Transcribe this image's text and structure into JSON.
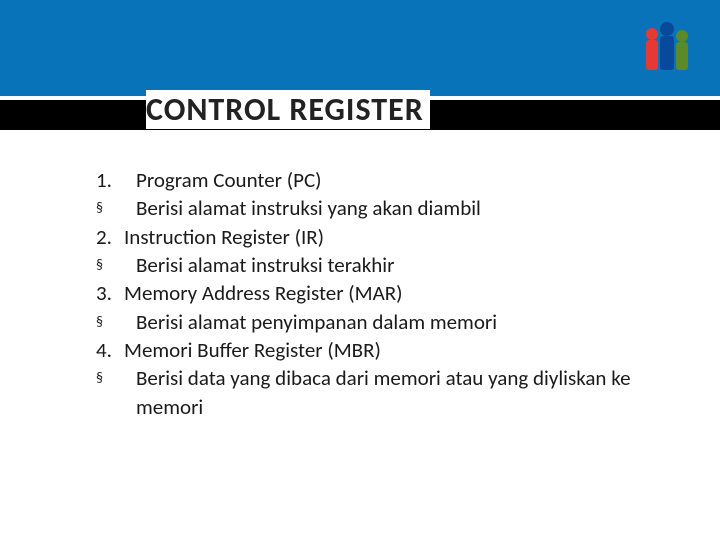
{
  "title": "CONTROL REGISTER",
  "items": [
    {
      "marker": "1.",
      "text": "Program Counter (PC)"
    },
    {
      "marker": "§",
      "text": "Berisi alamat instruksi yang akan diambil"
    },
    {
      "marker": "2.",
      "text": "Instruction Register (IR)"
    },
    {
      "marker": "§",
      "text": "Berisi alamat instruksi terakhir"
    },
    {
      "marker": "3.",
      "text": "Memory Address Register (MAR)"
    },
    {
      "marker": "§",
      "text": "Berisi alamat penyimpanan dalam memori"
    },
    {
      "marker": "4.",
      "text": "Memori Buffer Register (MBR)"
    },
    {
      "marker": "§",
      "text": "Berisi data yang dibaca dari memori atau yang diyliskan ke memori"
    }
  ]
}
